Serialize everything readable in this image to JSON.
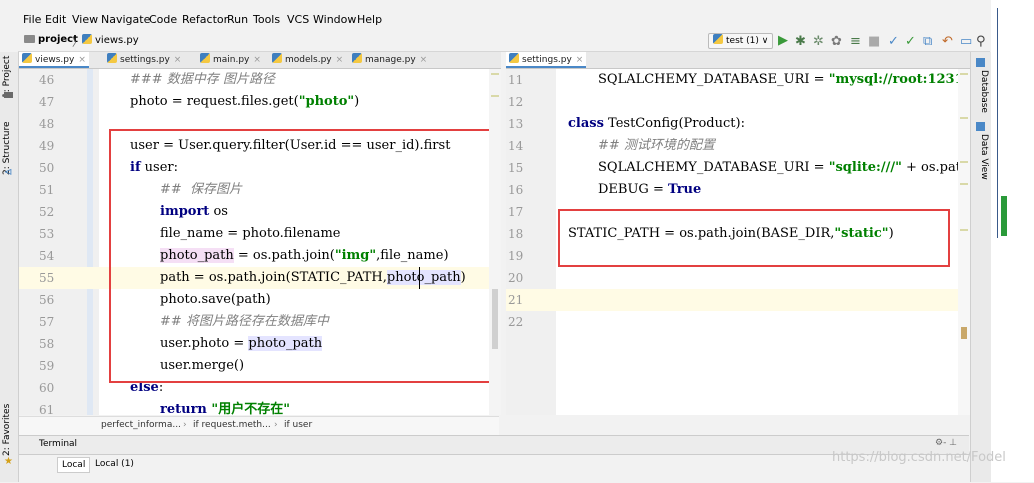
{
  "menu": [
    "File",
    "Edit",
    "View",
    "Navigate",
    "Code",
    "Refactor",
    "Run",
    "Tools",
    "VCS",
    "Window",
    "Help"
  ],
  "nav": {
    "project": "project",
    "file": "views.py",
    "run_config": "test (1)",
    "search_icon": "search-icon"
  },
  "left_tabs": [
    "views.py",
    "settings.py",
    "main.py",
    "models.py",
    "manage.py"
  ],
  "right_tabs": [
    "settings.py"
  ],
  "tool_labels": {
    "project": "1: Project",
    "structure": "2: Structure",
    "favorites": "2: Favorites",
    "database": "Database",
    "data_view": "Data View"
  },
  "left_editor": {
    "lines": [
      {
        "num": "46",
        "text": "### 数据中存 图片路径"
      },
      {
        "num": "47",
        "text": "photo = request.files.get(\"photo\")"
      },
      {
        "num": "48",
        "text": ""
      },
      {
        "num": "49",
        "text": "user = User.query.filter(User.id == user_id).first"
      },
      {
        "num": "50",
        "text": "if user:"
      },
      {
        "num": "51",
        "text": "##  保存图片"
      },
      {
        "num": "52",
        "text": "import os"
      },
      {
        "num": "53",
        "text": "file_name = photo.filename"
      },
      {
        "num": "54",
        "text": "photo_path = os.path.join(\"img\",file_name)"
      },
      {
        "num": "55",
        "text": "path = os.path.join(STATIC_PATH,photo_path)"
      },
      {
        "num": "56",
        "text": "photo.save(path)"
      },
      {
        "num": "57",
        "text": "## 将图片路径存在数据库中"
      },
      {
        "num": "58",
        "text": "user.photo = photo_path"
      },
      {
        "num": "59",
        "text": "user.merge()"
      },
      {
        "num": "60",
        "text": "else:"
      },
      {
        "num": "61",
        "text": "return \"用户不存在\""
      }
    ],
    "tokens": {
      "l47_a": "photo = request.files.get(",
      "l47_s": "\"photo\"",
      "l47_b": ")",
      "l50_kw": "if",
      "l50_b": " user:",
      "l52_kw": "import",
      "l52_b": " os",
      "l54_h": "photo_path",
      "l54_a": " = os.path.join(",
      "l54_s": "\"img\"",
      "l54_b": ",file_name)",
      "l55_a": "path = os.path.join(STATIC_PATH,",
      "l55_h": "photo_path",
      ")": ")",
      "l58_a": "user.photo = ",
      "l58_h": "photo_path",
      "l60_kw": "else",
      ":": ":",
      "l61_kw": "return",
      "l61_s": " \"用户不存在\""
    }
  },
  "right_editor": {
    "lines": [
      {
        "num": "11",
        "text": "SQLALCHEMY_DATABASE_URI = \"mysql://root:1231230"
      },
      {
        "num": "12",
        "text": ""
      },
      {
        "num": "13",
        "text": "class TestConfig(Product):"
      },
      {
        "num": "14",
        "text": "## 测试环境的配置"
      },
      {
        "num": "15",
        "text": "SQLALCHEMY_DATABASE_URI = \"sqlite:///\" + os.path."
      },
      {
        "num": "16",
        "text": "DEBUG = True"
      },
      {
        "num": "17",
        "text": ""
      },
      {
        "num": "18",
        "text": "STATIC_PATH = os.path.join(BASE_DIR,\"static\")"
      },
      {
        "num": "19",
        "text": ""
      },
      {
        "num": "20",
        "text": ""
      },
      {
        "num": "21",
        "text": ""
      },
      {
        "num": "22",
        "text": ""
      }
    ],
    "tokens": {
      "l11_a": "SQLALCHEMY_DATABASE_URI = ",
      "l11_s": "\"mysql://root:1231230",
      "l13_kw": "class",
      "l13_b": " TestConfig(Product):",
      "l15_a": "SQLALCHEMY_DATABASE_URI = ",
      "l15_s": "\"sqlite:///\"",
      "l15_b": " + os.path.",
      "l16_a": "DEBUG = ",
      "l16_kw": "True",
      "l18_a": "STATIC_PATH = os.path.join(BASE_DIR,",
      "l18_s": "\"static\"",
      "l18_b": ")"
    }
  },
  "breadcrumb": [
    "perfect_informa...",
    "if request.meth...",
    "if user"
  ],
  "terminal": {
    "title": "Terminal",
    "tabs": [
      "Local",
      "Local (1)"
    ],
    "settings": "⚙- ⊥"
  },
  "watermark": "https://blog.csdn.net/Fodel",
  "colors": {
    "keyword": "#000080",
    "string": "#008000",
    "comment": "#808080",
    "highlight": "#e4e4ff",
    "annotation_box": "#e34040"
  }
}
